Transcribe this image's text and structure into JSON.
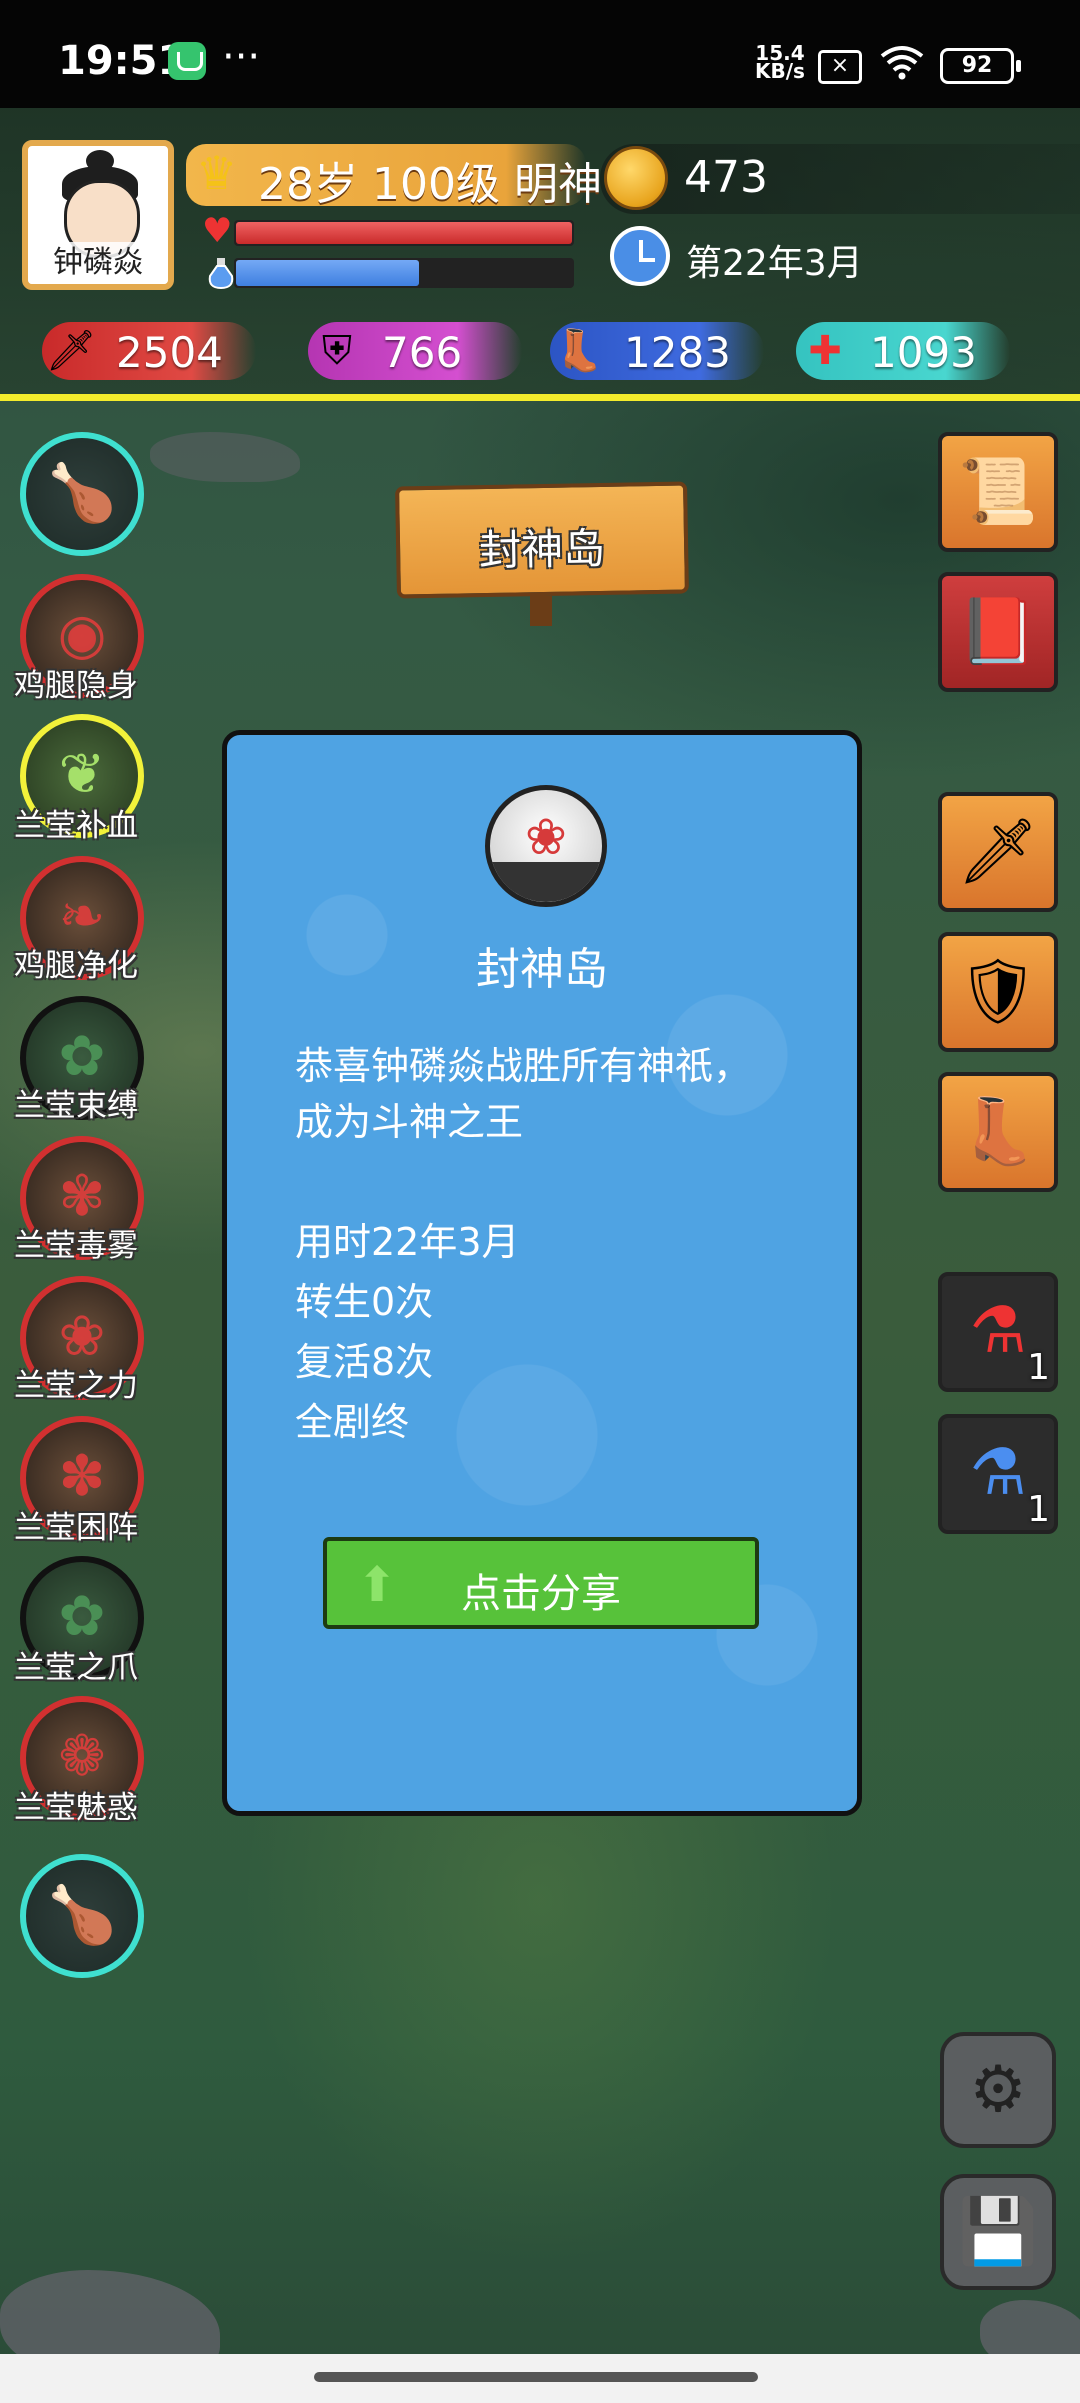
{
  "status_bar": {
    "time": "19:51",
    "dots": "···",
    "net_speed_value": "15.4",
    "net_speed_unit": "KB/s",
    "battery": "92"
  },
  "player": {
    "name": "钟磷焱",
    "rank_text": "28岁 100级 明神",
    "gold": "473",
    "date": "第22年3月",
    "hp_fraction": 1.0,
    "mp_fraction": 0.55
  },
  "stats": {
    "attack": "2504",
    "defense": "766",
    "speed": "1283",
    "heal": "1093"
  },
  "skills": [
    {
      "label": "",
      "style": "cyan",
      "icon": "drumstick-icon"
    },
    {
      "label": "鸡腿隐身",
      "style": "red",
      "icon": "stealth-icon"
    },
    {
      "label": "兰莹补血",
      "style": "yellow",
      "icon": "leaf-heal-icon"
    },
    {
      "label": "鸡腿净化",
      "style": "red",
      "icon": "purify-icon"
    },
    {
      "label": "兰莹束缚",
      "style": "black",
      "icon": "bind-icon"
    },
    {
      "label": "兰莹毒雾",
      "style": "red",
      "icon": "poison-icon"
    },
    {
      "label": "兰莹之力",
      "style": "red",
      "icon": "power-icon"
    },
    {
      "label": "兰莹困阵",
      "style": "red",
      "icon": "trap-icon"
    },
    {
      "label": "兰莹之爪",
      "style": "black",
      "icon": "claw-icon"
    },
    {
      "label": "兰莹魅惑",
      "style": "red",
      "icon": "charm-icon"
    },
    {
      "label": "",
      "style": "cyan",
      "icon": "drumstick-pet-icon"
    }
  ],
  "items": {
    "scroll": "scroll-map-icon",
    "book": "book-icon",
    "sword": "sword-icon",
    "armor": "armor-icon",
    "boots": "boots-icon",
    "hp_potion_count": "1",
    "mp_potion_count": "1"
  },
  "location_sign": "封神岛",
  "dialog": {
    "title": "封神岛",
    "line1": "恭喜钟磷焱战胜所有神祇，",
    "line2": "成为斗神之王",
    "line3": "用时22年3月",
    "line4": "转生0次",
    "line5": "复活8次",
    "line6": "全剧终",
    "share_button": "点击分享"
  },
  "colors": {
    "dialog_bg": "#4fa3e3",
    "share_green": "#57c23a",
    "divider_yellow": "#f4ec2c"
  }
}
